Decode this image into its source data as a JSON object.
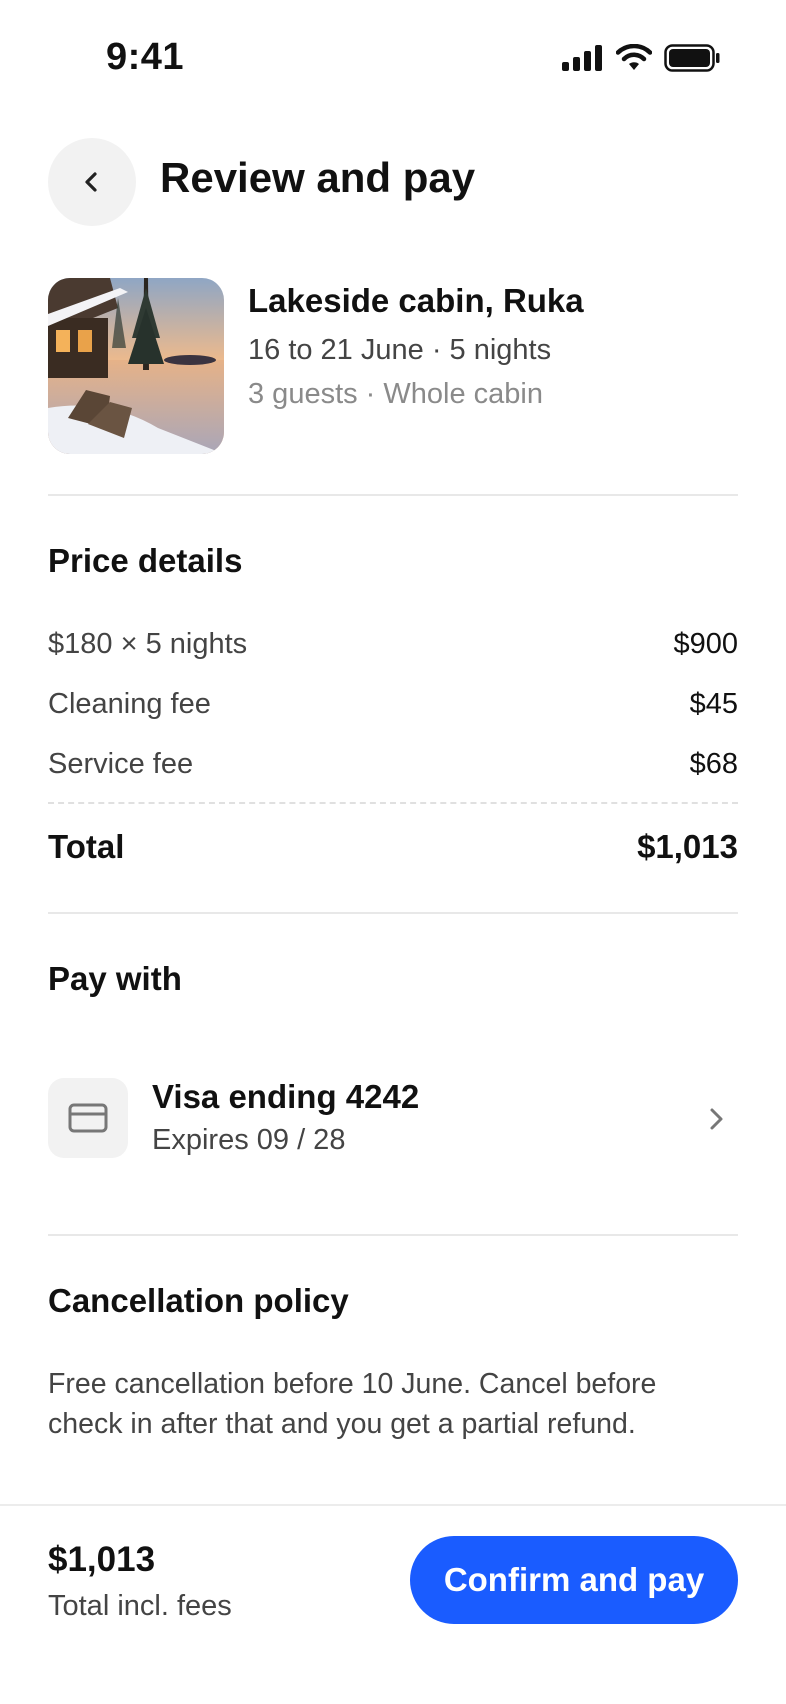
{
  "status_bar": {
    "time": "9:41",
    "icons": [
      "signal-icon",
      "wifi-icon",
      "battery-icon"
    ]
  },
  "header": {
    "title": "Review and pay",
    "back_icon": "chevron-left-icon"
  },
  "listing": {
    "title": "Lakeside cabin, Ruka",
    "dates": "16 to 21 June · 5 nights",
    "guests": "3 guests · Whole cabin",
    "photo_description": "lakeside-cabin-photo"
  },
  "price_details": {
    "title": "Price details",
    "rows": [
      {
        "label": "$180 × 5 nights",
        "value": "$900"
      },
      {
        "label": "Cleaning fee",
        "value": "$45"
      },
      {
        "label": "Service fee",
        "value": "$68"
      }
    ],
    "total_label": "Total",
    "total_value": "$1,013"
  },
  "payment": {
    "title": "Pay with",
    "card_name": "Visa ending 4242",
    "card_expiry": "Expires 09 / 28",
    "card_icon": "credit-card-icon",
    "chevron_icon": "chevron-right-icon"
  },
  "cancellation": {
    "title": "Cancellation policy",
    "text": "Free cancellation before 10 June. Cancel before check in after that and you get a partial refund."
  },
  "footer": {
    "total": "$1,013",
    "total_caption": "Total incl. fees",
    "confirm_label": "Confirm and pay"
  },
  "colors": {
    "accent": "#1a5cff",
    "text_primary": "#111111",
    "text_secondary": "#444444",
    "text_muted": "#8a8a8a",
    "surface": "#f2f2f2",
    "divider": "#e8e8e8"
  }
}
